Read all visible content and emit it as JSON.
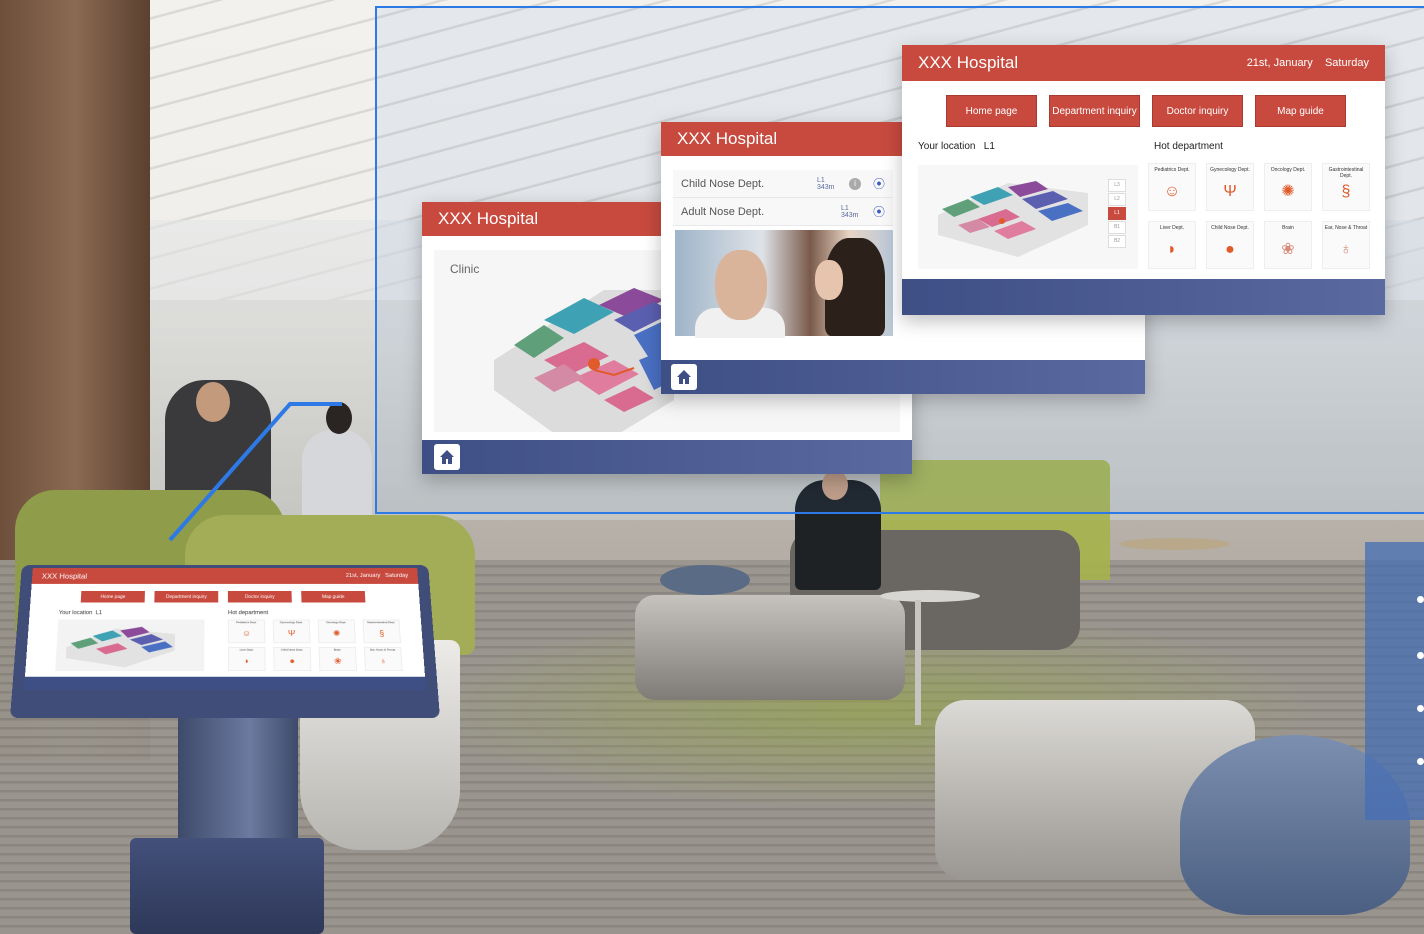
{
  "hospital_name": "XXX Hospital",
  "clinic_screen": {
    "title": "XXX Hospital",
    "section_label": "Clinic"
  },
  "ent_screen": {
    "title": "XXX Hospital",
    "rows": [
      {
        "label": "Child Nose Dept.",
        "meta": "L1 343m"
      },
      {
        "label": "Adult Nose Dept.",
        "meta": "L1 343m"
      }
    ]
  },
  "home_screen": {
    "title": "XXX Hospital",
    "date": "21st, January",
    "weekday": "Saturday",
    "nav": [
      "Home page",
      "Department inquiry",
      "Doctor inquiry",
      "Map guide"
    ],
    "location_label": "Your location",
    "location_value": "L1",
    "hot_label": "Hot department",
    "floors": [
      "L3",
      "L2",
      "L1",
      "B1",
      "B2"
    ],
    "active_floor": "L1",
    "departments": [
      {
        "name": "Pediatrics Dept.",
        "icon": "child-face-icon"
      },
      {
        "name": "Gynecology Dept.",
        "icon": "uterus-icon"
      },
      {
        "name": "Oncology Dept.",
        "icon": "virus-icon"
      },
      {
        "name": "Gastrointestinal Dept.",
        "icon": "intestine-icon"
      },
      {
        "name": "Liver Dept.",
        "icon": "liver-icon"
      },
      {
        "name": "Child Nose Dept.",
        "icon": "stomach-icon"
      },
      {
        "name": "Brain",
        "icon": "brain-icon"
      },
      {
        "name": "Ear, Nose & Throat",
        "icon": "nose-icon"
      }
    ]
  },
  "kiosk_screen": {
    "title": "XXX Hospital",
    "date": "21st, January",
    "weekday": "Saturday",
    "nav": [
      "Home page",
      "Department inquiry",
      "Doctor inquiry",
      "Map guide"
    ],
    "location_label": "Your location",
    "location_value": "L1",
    "hot_label": "Hot department",
    "departments": [
      "Pediatrics Dept.",
      "Gynecology Dept.",
      "Oncology Dept.",
      "Gastrointestinal Dept.",
      "Liver Dept.",
      "Child Nose Dept.",
      "Brain",
      "Ear, Nose & Throat"
    ]
  },
  "colors": {
    "header_red": "#c84a3f",
    "footer_blue": "#3e4f86",
    "highlight_blue": "#2d7ae6",
    "icon_orange": "#e05a2a"
  }
}
